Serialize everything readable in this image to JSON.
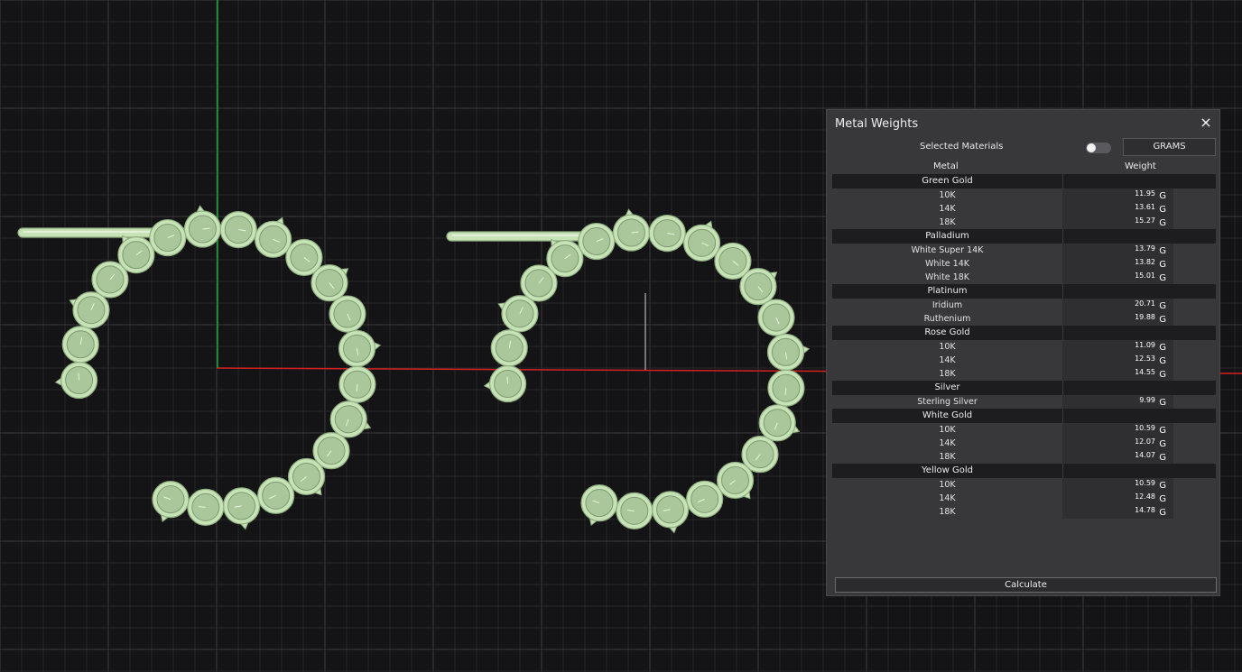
{
  "panel": {
    "title": "Metal Weights",
    "close_icon": "×",
    "selected_materials_label": "Selected Materials",
    "toggle_on": false,
    "unit_button": "GRAMS",
    "columns": {
      "metal": "Metal",
      "weight": "Weight"
    },
    "groups": [
      {
        "name": "Green Gold",
        "items": [
          {
            "name": "10K",
            "value": "11.95",
            "unit": "G"
          },
          {
            "name": "14K",
            "value": "13.61",
            "unit": "G"
          },
          {
            "name": "18K",
            "value": "15.27",
            "unit": "G"
          }
        ]
      },
      {
        "name": "Palladium",
        "items": [
          {
            "name": "White Super 14K",
            "value": "13.79",
            "unit": "G"
          },
          {
            "name": "White 14K",
            "value": "13.82",
            "unit": "G"
          },
          {
            "name": "White 18K",
            "value": "15.01",
            "unit": "G"
          }
        ]
      },
      {
        "name": "Platinum",
        "items": [
          {
            "name": "Iridium",
            "value": "20.71",
            "unit": "G"
          },
          {
            "name": "Ruthenium",
            "value": "19.88",
            "unit": "G"
          }
        ]
      },
      {
        "name": "Rose Gold",
        "items": [
          {
            "name": "10K",
            "value": "11.09",
            "unit": "G"
          },
          {
            "name": "14K",
            "value": "12.53",
            "unit": "G"
          },
          {
            "name": "18K",
            "value": "14.55",
            "unit": "G"
          }
        ]
      },
      {
        "name": "Silver",
        "items": [
          {
            "name": "Sterling Silver",
            "value": "9.99",
            "unit": "G"
          }
        ]
      },
      {
        "name": "White Gold",
        "items": [
          {
            "name": "10K",
            "value": "10.59",
            "unit": "G"
          },
          {
            "name": "14K",
            "value": "12.07",
            "unit": "G"
          },
          {
            "name": "18K",
            "value": "14.07",
            "unit": "G"
          }
        ]
      },
      {
        "name": "Yellow Gold",
        "items": [
          {
            "name": "10K",
            "value": "10.59",
            "unit": "G"
          },
          {
            "name": "14K",
            "value": "12.48",
            "unit": "G"
          },
          {
            "name": "18K",
            "value": "14.78",
            "unit": "G"
          }
        ]
      }
    ],
    "calculate_button": "Calculate"
  },
  "colors": {
    "background": "#141416",
    "grid_minor": "#262629",
    "grid_major": "#3a3a3e",
    "axis_x": "#d62020",
    "axis_y": "#1fa33a",
    "model_fill": "#c6e2b6",
    "model_stroke": "#8fae80",
    "panel_bg": "#38383b"
  },
  "icons": {
    "close": "close-icon"
  }
}
